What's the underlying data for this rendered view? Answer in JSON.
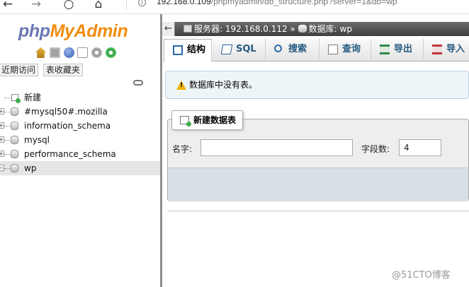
{
  "browser": {
    "back_glyph": "←",
    "forward_glyph": "→",
    "reload_glyph": "○",
    "home_glyph": "⌂",
    "info_glyph": "i",
    "url_host": "192.168.0.109",
    "url_path": "/phpmyadmin/db_structure.php?server=1&db=wp"
  },
  "logo": {
    "php": "php",
    "rest": "MyAdmin"
  },
  "quick_icons": [
    "home-icon",
    "exit-icon",
    "help-icon",
    "docs-icon",
    "settings-icon",
    "reload-icon"
  ],
  "left_tabs": {
    "recent": "近期访问",
    "favorites": "表收藏夹"
  },
  "tree": {
    "new_label": "新建",
    "expander_glyph": "+",
    "collapse_glyph": "−",
    "databases": [
      "#mysql50#.mozilla",
      "information_schema",
      "mysql",
      "performance_schema",
      "wp"
    ],
    "selected": "wp"
  },
  "breadcrumb": {
    "collapse_glyph": "←",
    "server_label": "服务器: 192.168.0.112",
    "separator": "»",
    "database_label": "数据库: wp"
  },
  "tabs": [
    {
      "label": "结构",
      "icon": "structure-icon",
      "active": true
    },
    {
      "label": "SQL",
      "icon": "sql-icon",
      "active": false
    },
    {
      "label": "搜索",
      "icon": "search-icon",
      "active": false
    },
    {
      "label": "查询",
      "icon": "query-icon",
      "active": false
    },
    {
      "label": "导出",
      "icon": "export-icon",
      "active": false
    },
    {
      "label": "导入",
      "icon": "import-icon",
      "active": false
    }
  ],
  "notice": {
    "text": "数据库中没有表。"
  },
  "create_table": {
    "legend": "新建数据表",
    "name_label": "名字:",
    "name_value": "",
    "fields_label": "字段数:",
    "fields_value": "4"
  },
  "watermark": "@51CTO博客",
  "colors": {
    "logo_php": "#6c78b3",
    "logo_myadmin": "#f38c0f",
    "breadcrumb_bg": "#4d4d4d",
    "tab_link": "#235a81",
    "notice_bg": "#eef5f9"
  }
}
